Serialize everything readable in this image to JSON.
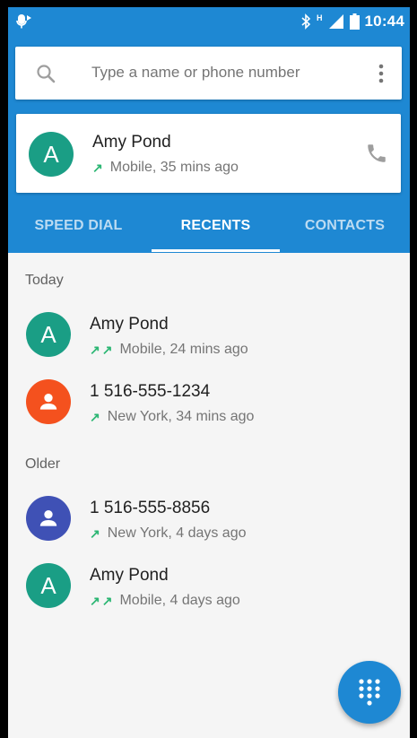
{
  "status_bar": {
    "time": "10:44",
    "network": "H",
    "icons": [
      "voicemail-icon",
      "bluetooth-icon",
      "signal-icon",
      "battery-icon"
    ]
  },
  "search": {
    "placeholder": "Type a name or phone number"
  },
  "pinned_contact": {
    "name": "Amy Pond",
    "initial": "A",
    "detail": "Mobile, 35 mins ago",
    "avatar_color": "#1a9e85"
  },
  "tabs": [
    {
      "label": "SPEED DIAL"
    },
    {
      "label": "RECENTS"
    },
    {
      "label": "CONTACTS"
    }
  ],
  "sections": [
    {
      "title": "Today",
      "items": [
        {
          "name": "Amy Pond",
          "initial": "A",
          "arrows": "↗↗",
          "detail": "Mobile, 24 mins ago",
          "avatar_color": "#1a9e85"
        },
        {
          "name": "1 516-555-1234",
          "initial": "",
          "arrows": "↗",
          "detail": "New York, 34 mins ago",
          "avatar_color": "#f4511e"
        }
      ]
    },
    {
      "title": "Older",
      "items": [
        {
          "name": "1 516-555-8856",
          "initial": "",
          "arrows": "↗",
          "detail": "New York, 4 days ago",
          "avatar_color": "#3f51b5"
        },
        {
          "name": "Amy Pond",
          "initial": "A",
          "arrows": "↗↗",
          "detail": "Mobile, 4 days ago",
          "avatar_color": "#1a9e85"
        }
      ]
    }
  ],
  "colors": {
    "accent": "#1e88d3",
    "outgoing_call": "#2bb673"
  }
}
